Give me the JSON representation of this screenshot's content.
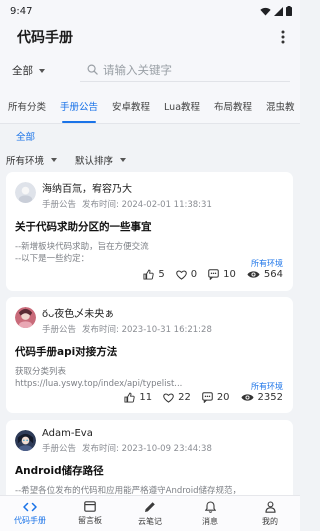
{
  "status_bar": {
    "time": "9:47"
  },
  "app_bar": {
    "title": "代码手册",
    "more_icon": "more-vert-icon"
  },
  "search": {
    "scope": "全部",
    "placeholder": "请输入关键字"
  },
  "tabs": [
    {
      "label": "所有分类",
      "active": false
    },
    {
      "label": "手册公告",
      "active": true
    },
    {
      "label": "安卓教程",
      "active": false
    },
    {
      "label": "Lua教程",
      "active": false
    },
    {
      "label": "布局教程",
      "active": false
    },
    {
      "label": "混虫教",
      "active": false
    }
  ],
  "sub_filter": {
    "label": "全部"
  },
  "filters": {
    "environment": "所有环境",
    "sort": "默认排序"
  },
  "posts": [
    {
      "author": "海纳百氚，宥容乃大",
      "category": "手册公告",
      "time": "发布时间: 2024-02-01 11:38:31",
      "title": "关于代码求助分区的一些事宜",
      "excerpt": "--新增板块代码求助，旨在方便交流\n--以下是一些约定：",
      "env": "所有环境",
      "likes": "5",
      "favorites": "0",
      "comments": "10",
      "views": "564"
    },
    {
      "author": "ο᷄ᴗ夜色乄未央ぁ",
      "category": "手册公告",
      "time": "发布时间: 2023-10-31 16:21:28",
      "title": "代码手册api对接方法",
      "excerpt": "获取分类列表\nhttps://lua.yswy.top/index/api/typelist...",
      "env": "所有环境",
      "likes": "11",
      "favorites": "22",
      "comments": "20",
      "views": "2352"
    },
    {
      "author": "Adam-Eva",
      "category": "手册公告",
      "time": "发布时间: 2023-10-09 23:44:38",
      "title": "Android储存路径",
      "excerpt": "--希望各位发布的代码和应用能严格遵守Android储存规范，",
      "env": "",
      "likes": "",
      "favorites": "",
      "comments": "",
      "views": ""
    }
  ],
  "bottom_nav": [
    {
      "label": "代码手册",
      "icon": "code-icon",
      "active": true
    },
    {
      "label": "留言板",
      "icon": "message-board-icon",
      "active": false
    },
    {
      "label": "云笔记",
      "icon": "pen-icon",
      "active": false
    },
    {
      "label": "消息",
      "icon": "bell-icon",
      "active": false
    },
    {
      "label": "我的",
      "icon": "person-icon",
      "active": false
    }
  ],
  "colors": {
    "accent": "#1a73e8",
    "background": "#f1f3f6",
    "card": "#ffffff"
  }
}
